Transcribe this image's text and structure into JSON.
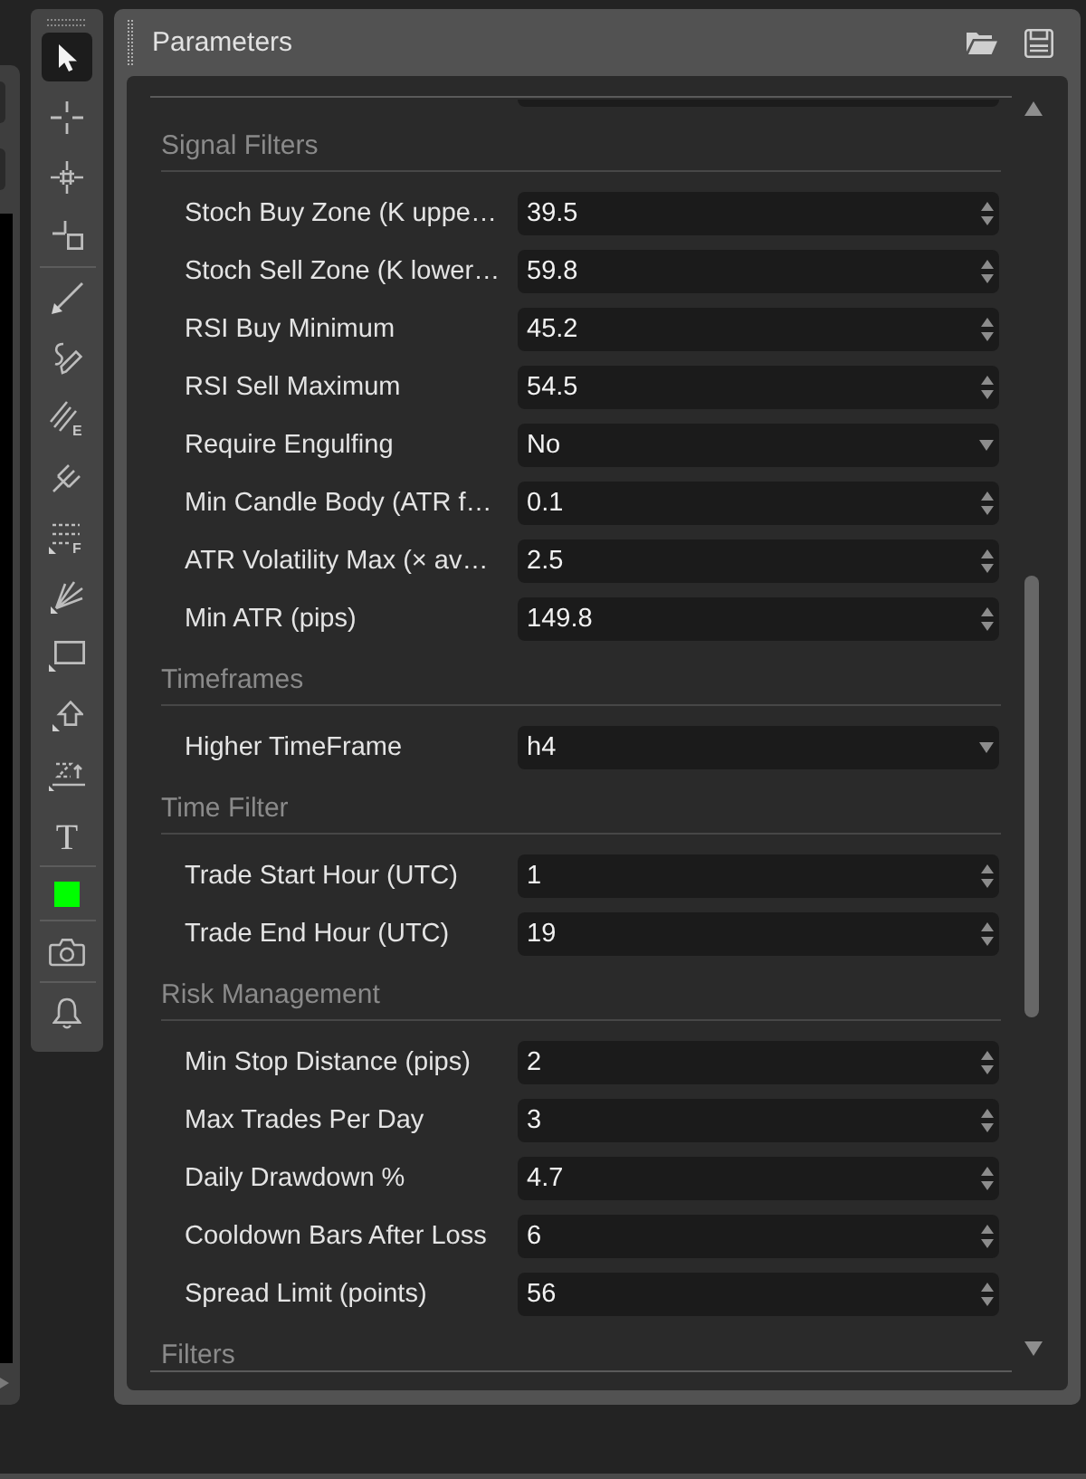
{
  "toolbar": {
    "groups": [
      {
        "tools": [
          {
            "kind": "cursor",
            "selected": true
          },
          {
            "kind": "crosshair",
            "selected": false
          },
          {
            "kind": "multicrosshair",
            "selected": false
          },
          {
            "kind": "measure",
            "selected": false
          }
        ]
      },
      {
        "tools": [
          {
            "kind": "line",
            "selected": false
          },
          {
            "kind": "pen",
            "selected": false
          },
          {
            "kind": "hatch",
            "letter": "E",
            "selected": false
          },
          {
            "kind": "pitchfork",
            "selected": false
          },
          {
            "kind": "dotted",
            "letter": "F",
            "selected": false
          },
          {
            "kind": "fan",
            "selected": false
          },
          {
            "kind": "rectangle",
            "selected": false
          },
          {
            "kind": "arrow",
            "selected": false
          },
          {
            "kind": "zigzag",
            "selected": false
          },
          {
            "kind": "text",
            "letter": "T",
            "selected": false
          }
        ]
      },
      {
        "tools": [
          {
            "kind": "swatch",
            "color": "#00ff00",
            "selected": false
          }
        ]
      },
      {
        "tools": [
          {
            "kind": "camera",
            "selected": false
          }
        ]
      },
      {
        "tools": [
          {
            "kind": "bell",
            "selected": false
          }
        ]
      }
    ]
  },
  "panel": {
    "title": "Parameters",
    "sections": [
      {
        "title": "Signal Filters",
        "params": [
          {
            "label": "Stoch Buy Zone (K uppe…",
            "kind": "number",
            "value": "39.5"
          },
          {
            "label": "Stoch Sell Zone (K lower…",
            "kind": "number",
            "value": "59.8"
          },
          {
            "label": "RSI Buy Minimum",
            "kind": "number",
            "value": "45.2"
          },
          {
            "label": "RSI Sell Maximum",
            "kind": "number",
            "value": "54.5"
          },
          {
            "label": "Require Engulfing",
            "kind": "select",
            "value": "No"
          },
          {
            "label": "Min Candle Body (ATR f…",
            "kind": "number",
            "value": "0.1"
          },
          {
            "label": "ATR Volatility Max (× av…",
            "kind": "number",
            "value": "2.5"
          },
          {
            "label": "Min ATR (pips)",
            "kind": "number",
            "value": "149.8"
          }
        ]
      },
      {
        "title": "Timeframes",
        "params": [
          {
            "label": "Higher TimeFrame",
            "kind": "select",
            "value": "h4"
          }
        ]
      },
      {
        "title": "Time Filter",
        "params": [
          {
            "label": "Trade Start Hour (UTC)",
            "kind": "number",
            "value": "1"
          },
          {
            "label": "Trade End Hour (UTC)",
            "kind": "number",
            "value": "19"
          }
        ]
      },
      {
        "title": "Risk Management",
        "params": [
          {
            "label": "Min Stop Distance (pips)",
            "kind": "number",
            "value": "2"
          },
          {
            "label": "Max Trades Per Day",
            "kind": "number",
            "value": "3"
          },
          {
            "label": "Daily Drawdown %",
            "kind": "number",
            "value": "4.7"
          },
          {
            "label": "Cooldown Bars After Loss",
            "kind": "number",
            "value": "6"
          },
          {
            "label": "Spread Limit (points)",
            "kind": "number",
            "value": "56"
          }
        ]
      },
      {
        "title": "Filters"
      }
    ]
  }
}
